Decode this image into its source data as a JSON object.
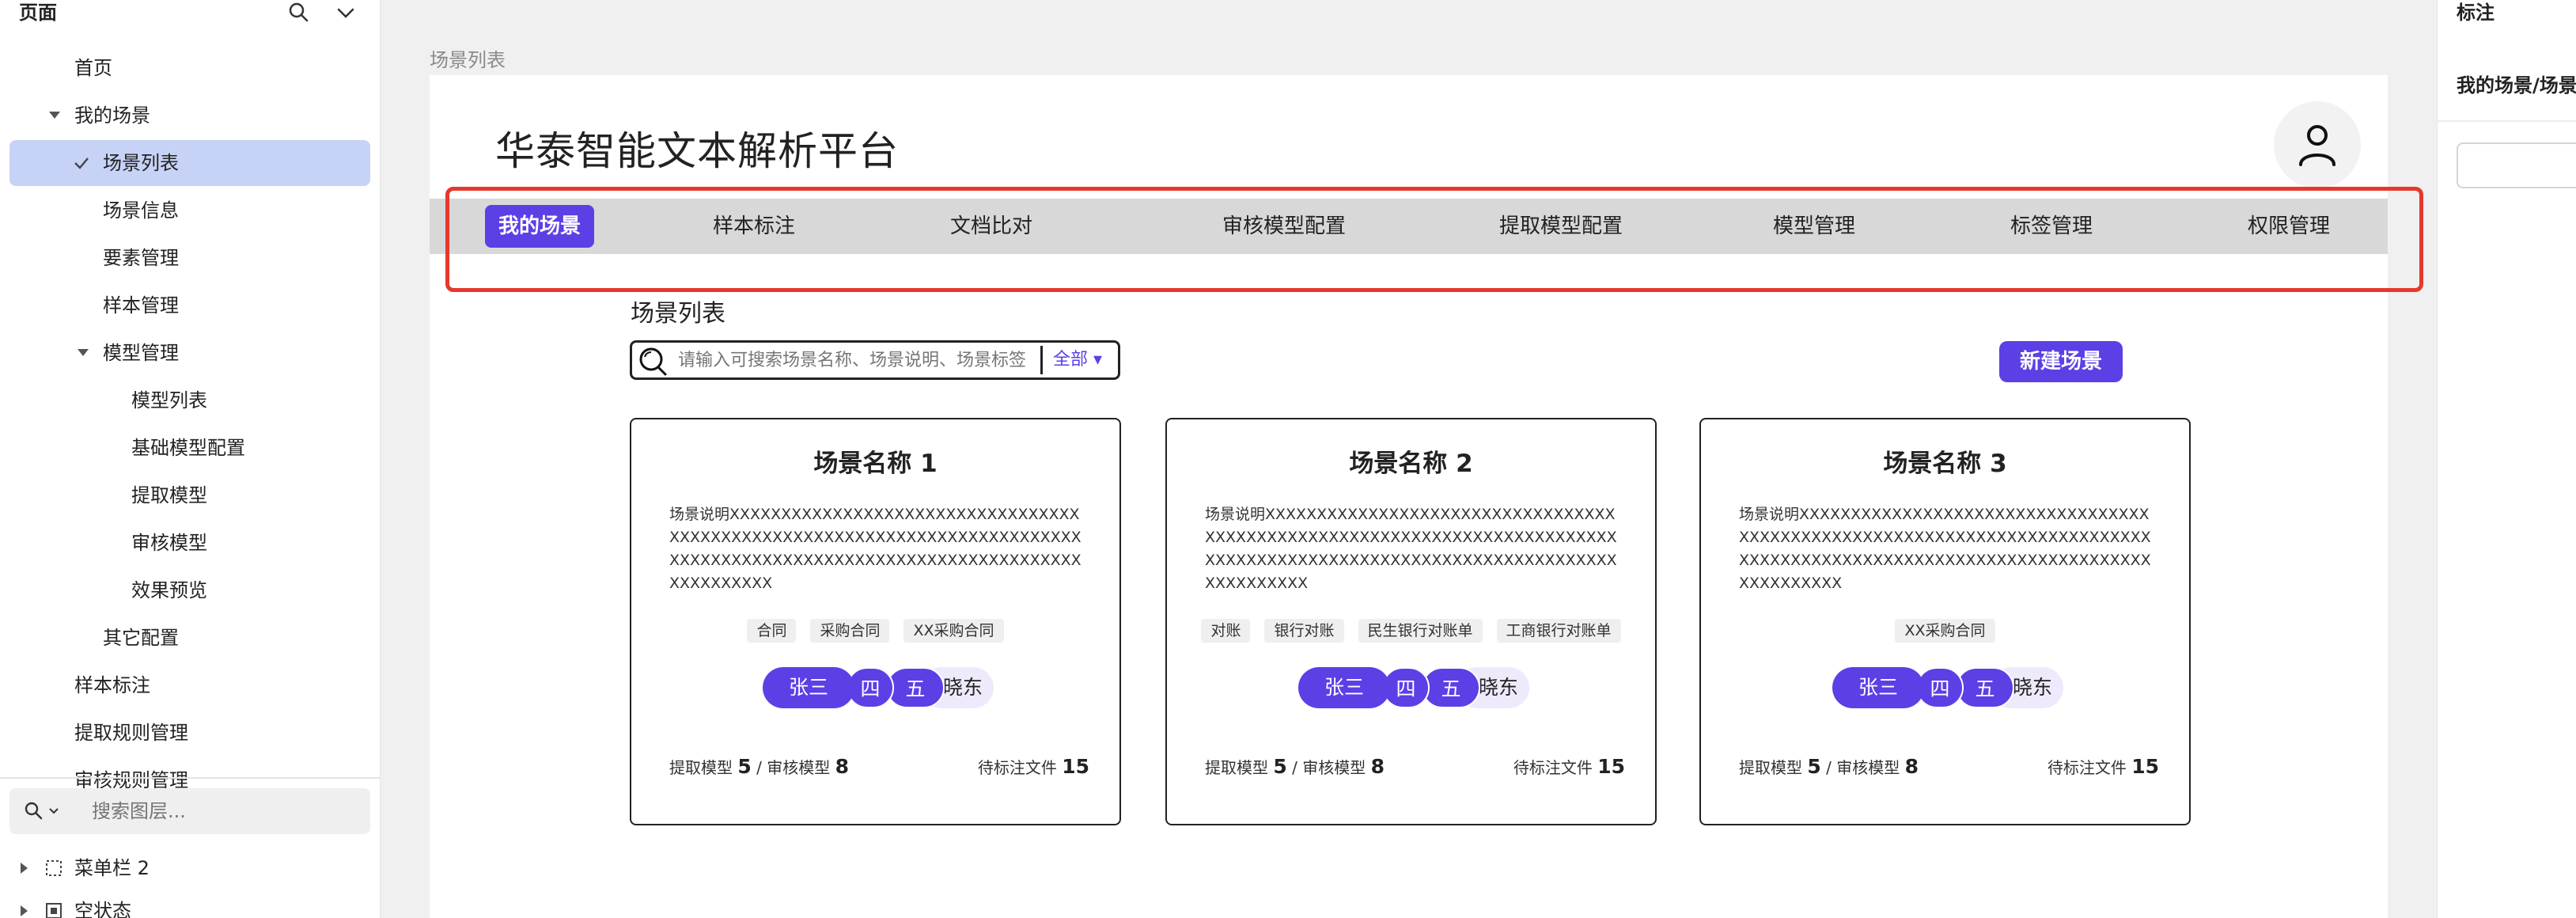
{
  "left_panel": {
    "title": "页面",
    "tree": [
      {
        "label": "首页",
        "level": 1
      },
      {
        "label": "我的场景",
        "level": 1,
        "expanded": true
      },
      {
        "label": "场景列表",
        "level": 2,
        "selected": true
      },
      {
        "label": "场景信息",
        "level": 2
      },
      {
        "label": "要素管理",
        "level": 2
      },
      {
        "label": "样本管理",
        "level": 2
      },
      {
        "label": "模型管理",
        "level": 2,
        "expanded": true
      },
      {
        "label": "模型列表",
        "level": 3
      },
      {
        "label": "基础模型配置",
        "level": 3
      },
      {
        "label": "提取模型",
        "level": 3
      },
      {
        "label": "审核模型",
        "level": 3
      },
      {
        "label": "效果预览",
        "level": 3
      },
      {
        "label": "其它配置",
        "level": 2
      },
      {
        "label": "样本标注",
        "level": 1
      },
      {
        "label": "提取规则管理",
        "level": 1
      },
      {
        "label": "审核规则管理",
        "level": 1
      }
    ],
    "layer_search_placeholder": "搜索图层...",
    "layers": [
      {
        "label": "菜单栏 2"
      },
      {
        "label": "空状态"
      }
    ]
  },
  "right_panel": {
    "title": "标注",
    "path": "我的场景/场景列表"
  },
  "canvas": {
    "frame_label": "场景列表",
    "app_title": "华泰智能文本解析平台",
    "nav_tabs": [
      {
        "label": "我的场景",
        "active": true
      },
      {
        "label": "样本标注"
      },
      {
        "label": "文档比对"
      },
      {
        "label": "审核模型配置"
      },
      {
        "label": "提取模型配置"
      },
      {
        "label": "模型管理"
      },
      {
        "label": "标签管理"
      },
      {
        "label": "权限管理"
      }
    ],
    "section_title": "场景列表",
    "search": {
      "placeholder": "请输入可搜索场景名称、场景说明、场景标签",
      "filter": "全部 ▾"
    },
    "new_scene_label": "新建场景",
    "cards": [
      {
        "title": "场景名称 1",
        "desc": "场景说明XXXXXXXXXXXXXXXXXXXXXXXXXXXXXXXXXXXXXXXXXXXXXXXXXXXXXXXXXXXXXXXXXXXXXXXXXXXXXXXXXXXXXXXXXXXXXXXXXXXXXXXXXXXXXXXXXXXXXXXXXXXX",
        "tags": [
          "合同",
          "采购合同",
          "XX采购合同"
        ],
        "members": [
          "张三",
          "四",
          "五",
          "晓东"
        ],
        "extract_label": "提取模型",
        "extract_count": "5",
        "review_label": " / 审核模型",
        "review_count": "8",
        "pending_label": "待标注文件",
        "pending_count": "15"
      },
      {
        "title": "场景名称 2",
        "desc": "场景说明XXXXXXXXXXXXXXXXXXXXXXXXXXXXXXXXXXXXXXXXXXXXXXXXXXXXXXXXXXXXXXXXXXXXXXXXXXXXXXXXXXXXXXXXXXXXXXXXXXXXXXXXXXXXXXXXXXXXXXXXXXXX",
        "tags": [
          "对账",
          "银行对账",
          "民生银行对账单",
          "工商银行对账单"
        ],
        "members": [
          "张三",
          "四",
          "五",
          "晓东"
        ],
        "extract_label": "提取模型",
        "extract_count": "5",
        "review_label": " / 审核模型",
        "review_count": "8",
        "pending_label": "待标注文件",
        "pending_count": "15"
      },
      {
        "title": "场景名称 3",
        "desc": "场景说明XXXXXXXXXXXXXXXXXXXXXXXXXXXXXXXXXXXXXXXXXXXXXXXXXXXXXXXXXXXXXXXXXXXXXXXXXXXXXXXXXXXXXXXXXXXXXXXXXXXXXXXXXXXXXXXXXXXXXXXXXXXX",
        "tags": [
          "XX采购合同"
        ],
        "members": [
          "张三",
          "四",
          "五",
          "晓东"
        ],
        "extract_label": "提取模型",
        "extract_count": "5",
        "review_label": " / 审核模型",
        "review_count": "8",
        "pending_label": "待标注文件",
        "pending_count": "15"
      }
    ]
  },
  "colors": {
    "accent": "#5d3fe6",
    "highlight": "#e6382c",
    "selected_row": "#c7d3f6",
    "navbar": "#d8d8d8"
  }
}
